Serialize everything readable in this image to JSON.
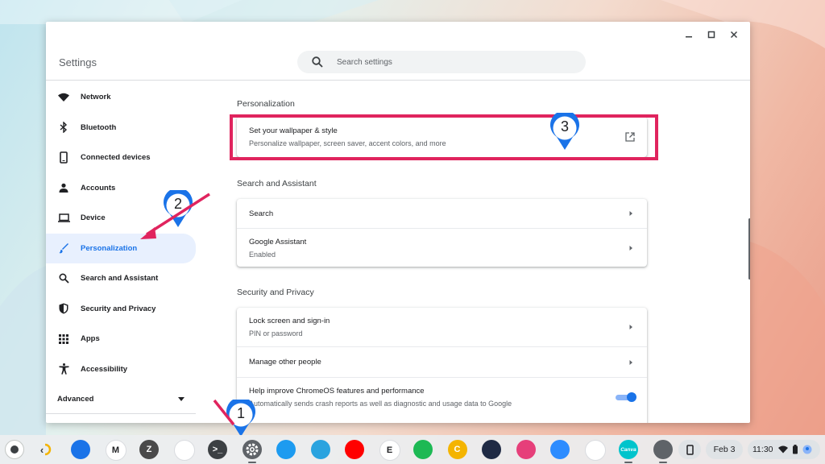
{
  "window": {
    "app_title": "Settings",
    "search_placeholder": "Search settings",
    "controls": [
      "minimize-icon",
      "maximize-icon",
      "close-icon"
    ]
  },
  "sidebar": {
    "items": [
      {
        "label": "Network",
        "icon": "wifi-icon"
      },
      {
        "label": "Bluetooth",
        "icon": "bluetooth-icon"
      },
      {
        "label": "Connected devices",
        "icon": "phone-icon"
      },
      {
        "label": "Accounts",
        "icon": "person-icon"
      },
      {
        "label": "Device",
        "icon": "laptop-icon"
      },
      {
        "label": "Personalization",
        "icon": "brush-icon",
        "active": true
      },
      {
        "label": "Search and Assistant",
        "icon": "search-icon"
      },
      {
        "label": "Security and Privacy",
        "icon": "shield-icon"
      },
      {
        "label": "Apps",
        "icon": "apps-grid-icon"
      },
      {
        "label": "Accessibility",
        "icon": "accessibility-icon"
      }
    ],
    "advanced_label": "Advanced"
  },
  "main": {
    "personalization": {
      "title": "Personalization",
      "wallpaper_title": "Set your wallpaper & style",
      "wallpaper_sub": "Personalize wallpaper, screen saver, accent colors, and more"
    },
    "search_assistant": {
      "title": "Search and Assistant",
      "search_label": "Search",
      "assistant_label": "Google Assistant",
      "assistant_sub": "Enabled"
    },
    "security": {
      "title": "Security and Privacy",
      "lock_label": "Lock screen and sign-in",
      "lock_sub": "PIN or password",
      "manage_label": "Manage other people",
      "improve_label": "Help improve ChromeOS features and performance",
      "improve_sub": "Automatically sends crash reports as well as diagnostic and usage data to Google",
      "improve_enabled": true
    }
  },
  "annotations": {
    "step1": "1",
    "step2": "2",
    "step3": "3",
    "color": "#e0245e",
    "pin_color": "#1a73e8"
  },
  "shelf": {
    "date": "Feb 3",
    "time": "11:30",
    "apps": [
      {
        "name": "files-icon",
        "color": "#1a73e8",
        "glyph": ""
      },
      {
        "name": "gmail-icon",
        "color": "#ffffff",
        "glyph": "M"
      },
      {
        "name": "z-app-icon",
        "color": "#4a4a4a",
        "glyph": "Z"
      },
      {
        "name": "google-drive-icon",
        "color": "#ffffff",
        "glyph": ""
      },
      {
        "name": "terminal-icon",
        "color": "#3c4043",
        "glyph": ">_"
      },
      {
        "name": "settings-icon",
        "color": "#5f6368",
        "glyph": ""
      },
      {
        "name": "twitter-icon",
        "color": "#1d9bf0",
        "glyph": ""
      },
      {
        "name": "telegram-icon",
        "color": "#2aa3df",
        "glyph": ""
      },
      {
        "name": "youtube-icon",
        "color": "#ff0000",
        "glyph": ""
      },
      {
        "name": "e-app-icon",
        "color": "#ffffff",
        "glyph": "E"
      },
      {
        "name": "spotify-icon",
        "color": "#1db954",
        "glyph": ""
      },
      {
        "name": "c-app-icon",
        "color": "#f4b400",
        "glyph": "C"
      },
      {
        "name": "screen-app-icon",
        "color": "#1f2a44",
        "glyph": ""
      },
      {
        "name": "photo-app-icon",
        "color": "#e63f7a",
        "glyph": ""
      },
      {
        "name": "zoom-icon",
        "color": "#2d8cff",
        "glyph": ""
      },
      {
        "name": "play-store-icon",
        "color": "#ffffff",
        "glyph": ""
      },
      {
        "name": "canva-icon",
        "color": "#00c4cc",
        "glyph": "Canva"
      },
      {
        "name": "screenshot-app-icon",
        "color": "#5f6368",
        "glyph": ""
      }
    ]
  }
}
